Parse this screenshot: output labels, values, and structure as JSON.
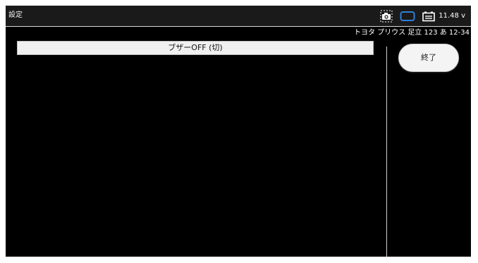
{
  "titlebar": {
    "title": "設定",
    "icons": [
      "camera-icon",
      "monitor-icon",
      "battery-icon"
    ],
    "voltage": "11.48 v"
  },
  "vehicle": {
    "info": "トヨタ プリウス 足立 123 あ 12-34"
  },
  "main": {
    "items": [
      {
        "label": "ブザーOFF (切)"
      }
    ]
  },
  "side": {
    "end_label": "終了"
  },
  "colors": {
    "screen_bg": "#000000",
    "titlebar_bg": "#1a1a1a",
    "monitor_icon": "#2f7fd8",
    "item_bg": "#f0f0f0",
    "button_bg": "#f4f4f4"
  }
}
